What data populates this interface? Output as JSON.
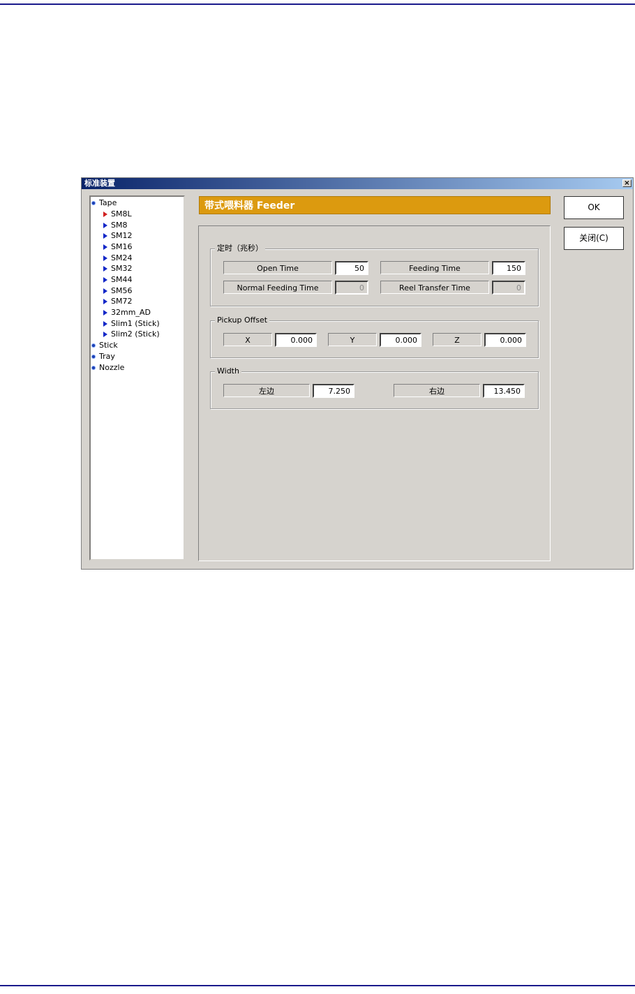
{
  "dialog": {
    "title": "标准装置",
    "close_glyph": "×"
  },
  "tree": {
    "root_items": [
      "Tape",
      "Stick",
      "Tray",
      "Nozzle"
    ],
    "tape_children": [
      "SM8L",
      "SM8",
      "SM12",
      "SM16",
      "SM24",
      "SM32",
      "SM44",
      "SM56",
      "SM72",
      "32mm_AD",
      "Slim1 (Stick)",
      "Slim2 (Stick)"
    ],
    "selected": "SM8L"
  },
  "header": {
    "title": "带式喂料器 Feeder"
  },
  "timing": {
    "group_title": "定时（兆秒）",
    "open_time_label": "Open Time",
    "open_time_value": "50",
    "feeding_time_label": "Feeding Time",
    "feeding_time_value": "150",
    "normal_feeding_label": "Normal Feeding Time",
    "normal_feeding_value": "0",
    "reel_transfer_label": "Reel Transfer Time",
    "reel_transfer_value": "0"
  },
  "pickup": {
    "group_title": "Pickup Offset",
    "x_label": "X",
    "x_value": "0.000",
    "y_label": "Y",
    "y_value": "0.000",
    "z_label": "Z",
    "z_value": "0.000"
  },
  "width": {
    "group_title": "Width",
    "left_label": "左边",
    "left_value": "7.250",
    "right_label": "右边",
    "right_value": "13.450"
  },
  "buttons": {
    "ok": "OK",
    "close": "关闭(C)"
  },
  "colors": {
    "header_bg": "#dc9a0f",
    "selected_arrow": "#d02020",
    "arrow": "#1428c8",
    "page_rule": "#1a1a8c"
  }
}
